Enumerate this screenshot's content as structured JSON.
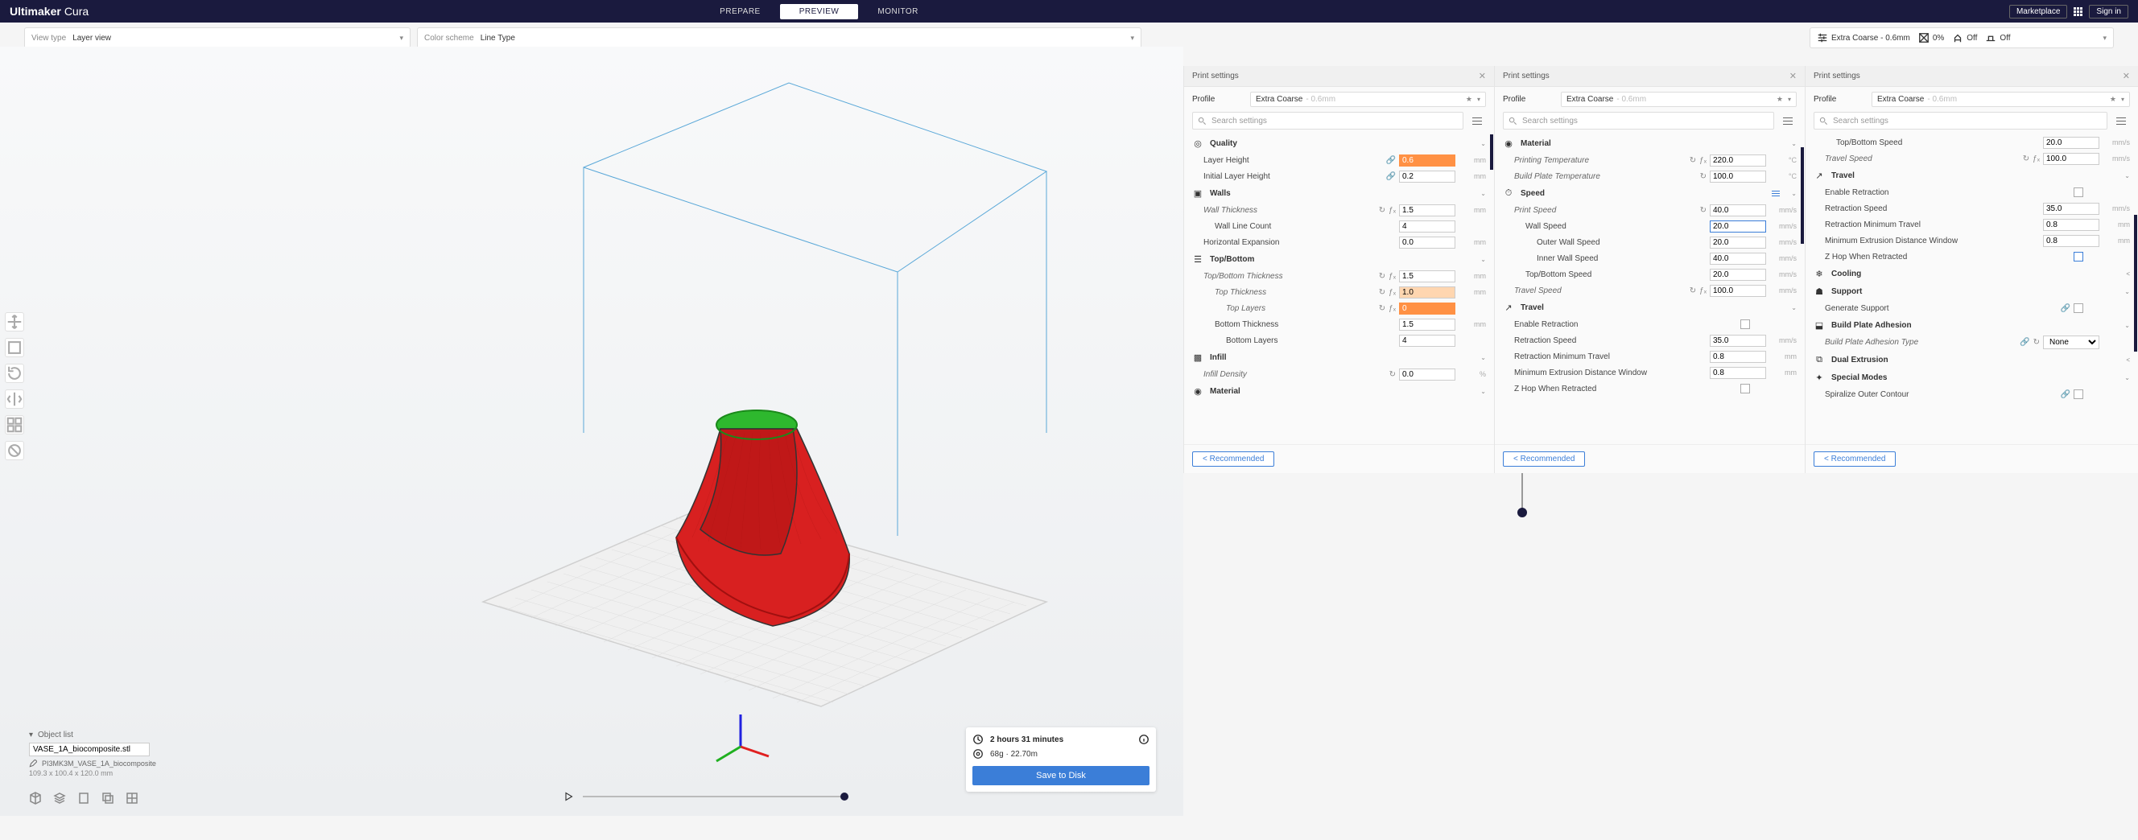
{
  "brand": {
    "bold": "Ultimaker",
    "light": "Cura"
  },
  "nav": {
    "prepare": "PREPARE",
    "preview": "PREVIEW",
    "monitor": "MONITOR",
    "marketplace": "Marketplace",
    "signin": "Sign in"
  },
  "toolbar": {
    "view_type_label": "View type",
    "view_type_value": "Layer view",
    "color_label": "Color scheme",
    "color_value": "Line Type",
    "preset": "Extra Coarse - 0.6mm",
    "infill_pct": "0%",
    "support": "Off",
    "adhesion": "Off"
  },
  "panel_title": "Print settings",
  "profile_label": "Profile",
  "profile_value": "Extra Coarse",
  "profile_dim": "- 0.6mm",
  "search_placeholder": "Search settings",
  "recommended": "Recommended",
  "sections": {
    "quality": "Quality",
    "walls": "Walls",
    "topbottom": "Top/Bottom",
    "infill": "Infill",
    "material": "Material",
    "speed": "Speed",
    "travel": "Travel",
    "cooling": "Cooling",
    "support": "Support",
    "adhesion": "Build Plate Adhesion",
    "dual": "Dual Extrusion",
    "special": "Special Modes"
  },
  "p1": {
    "layer_height": {
      "l": "Layer Height",
      "v": "0.6",
      "u": "mm"
    },
    "initial_layer": {
      "l": "Initial Layer Height",
      "v": "0.2",
      "u": "mm"
    },
    "wall_thick": {
      "l": "Wall Thickness",
      "v": "1.5",
      "u": "mm"
    },
    "wall_line": {
      "l": "Wall Line Count",
      "v": "4",
      "u": ""
    },
    "horiz_exp": {
      "l": "Horizontal Expansion",
      "v": "0.0",
      "u": "mm"
    },
    "tb_thick": {
      "l": "Top/Bottom Thickness",
      "v": "1.5",
      "u": "mm"
    },
    "top_thick": {
      "l": "Top Thickness",
      "v": "1.0",
      "u": "mm"
    },
    "top_layers": {
      "l": "Top Layers",
      "v": "0",
      "u": ""
    },
    "bot_thick": {
      "l": "Bottom Thickness",
      "v": "1.5",
      "u": "mm"
    },
    "bot_layers": {
      "l": "Bottom Layers",
      "v": "4",
      "u": ""
    },
    "infill_dens": {
      "l": "Infill Density",
      "v": "0.0",
      "u": "%"
    },
    "print_temp_part": {
      "l": "Printing Temperature",
      "v": "220.0"
    }
  },
  "p2": {
    "print_temp": {
      "l": "Printing Temperature",
      "v": "220.0",
      "u": "°C"
    },
    "bp_temp": {
      "l": "Build Plate Temperature",
      "v": "100.0",
      "u": "°C"
    },
    "print_speed": {
      "l": "Print Speed",
      "v": "40.0",
      "u": "mm/s"
    },
    "wall_speed": {
      "l": "Wall Speed",
      "v": "20.0",
      "u": "mm/s"
    },
    "outer_wall": {
      "l": "Outer Wall Speed",
      "v": "20.0",
      "u": "mm/s"
    },
    "inner_wall": {
      "l": "Inner Wall Speed",
      "v": "40.0",
      "u": "mm/s"
    },
    "tb_speed": {
      "l": "Top/Bottom Speed",
      "v": "20.0",
      "u": "mm/s"
    },
    "travel_speed": {
      "l": "Travel Speed",
      "v": "100.0",
      "u": "mm/s"
    },
    "enable_retr": {
      "l": "Enable Retraction"
    },
    "retr_speed": {
      "l": "Retraction Speed",
      "v": "35.0",
      "u": "mm/s"
    },
    "retr_min": {
      "l": "Retraction Minimum Travel",
      "v": "0.8",
      "u": "mm"
    },
    "min_ext": {
      "l": "Minimum Extrusion Distance Window",
      "v": "0.8",
      "u": "mm"
    },
    "zhop": {
      "l": "Z Hop When Retracted"
    },
    "cooling_part": {
      "l": "Cooling"
    }
  },
  "p3": {
    "outer_wall_sp": {
      "l": "Outer Wall Speed",
      "v": "20.0",
      "u": "mm/s"
    },
    "tb_speed": {
      "l": "Top/Bottom Speed",
      "v": "20.0",
      "u": "mm/s"
    },
    "travel_speed": {
      "l": "Travel Speed",
      "v": "100.0",
      "u": "mm/s"
    },
    "enable_retr": {
      "l": "Enable Retraction"
    },
    "retr_speed": {
      "l": "Retraction Speed",
      "v": "35.0",
      "u": "mm/s"
    },
    "retr_min": {
      "l": "Retraction Minimum Travel",
      "v": "0.8",
      "u": "mm"
    },
    "min_ext": {
      "l": "Minimum Extrusion Distance Window",
      "v": "0.8",
      "u": "mm"
    },
    "zhop": {
      "l": "Z Hop When Retracted"
    },
    "gen_support": {
      "l": "Generate Support"
    },
    "bp_type": {
      "l": "Build Plate Adhesion Type",
      "v": "None"
    },
    "spiralize": {
      "l": "Spiralize Outer Contour"
    }
  },
  "object": {
    "list_label": "Object list",
    "name": "VASE_1A_biocomposite.stl",
    "full": "PI3MK3M_VASE_1A_biocomposite",
    "dims": "109.3 x 100.4 x 120.0 mm"
  },
  "slice": {
    "time": "2 hours 31 minutes",
    "material": "68g · 22.70m",
    "save": "Save to Disk"
  }
}
